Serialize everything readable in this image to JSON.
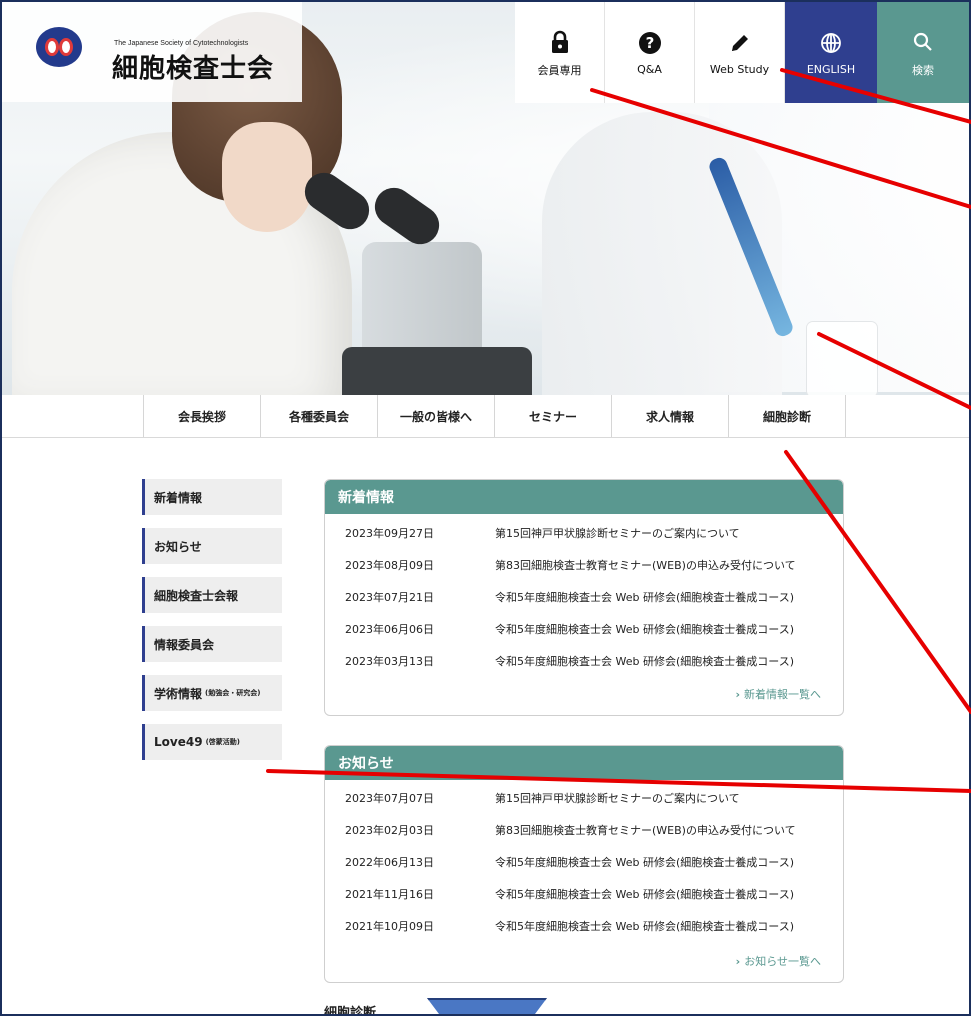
{
  "header": {
    "logo_subtitle": "The Japanese Society of Cytotechnologists",
    "logo_title": "細胞検査士会"
  },
  "topnav": [
    {
      "label": "会員専用",
      "icon": "lock-icon"
    },
    {
      "label": "Q&A",
      "icon": "question-circle-icon"
    },
    {
      "label": "Web Study",
      "icon": "pencil-icon"
    },
    {
      "label": "ENGLISH",
      "icon": "globe-icon"
    },
    {
      "label": "検索",
      "icon": "search-icon"
    }
  ],
  "gnav": [
    "会長挨拶",
    "各種委員会",
    "一般の皆様へ",
    "セミナー",
    "求人情報",
    "細胞診断"
  ],
  "side": [
    {
      "label": "新着情報",
      "note": ""
    },
    {
      "label": "お知らせ",
      "note": ""
    },
    {
      "label": "細胞検査士会報",
      "note": ""
    },
    {
      "label": "情報委員会",
      "note": ""
    },
    {
      "label": "学術情報",
      "note": "(勉強会・研究会)"
    },
    {
      "label": "Love49",
      "note": "(啓蒙活動)"
    }
  ],
  "news": {
    "title": "新着情報",
    "rows": [
      {
        "date": "2023年09月27日",
        "title": "第15回神戸甲状腺診断セミナーのご案内について"
      },
      {
        "date": "2023年08月09日",
        "title": "第83回細胞検査士教育セミナー(WEB)の申込み受付について"
      },
      {
        "date": "2023年07月21日",
        "title": "令和5年度細胞検査士会 Web 研修会(細胞検査士養成コース)"
      },
      {
        "date": "2023年06月06日",
        "title": "令和5年度細胞検査士会 Web 研修会(細胞検査士養成コース)"
      },
      {
        "date": "2023年03月13日",
        "title": "令和5年度細胞検査士会 Web 研修会(細胞検査士養成コース)"
      }
    ],
    "more": "新着情報一覧へ"
  },
  "notice": {
    "title": "お知らせ",
    "rows": [
      {
        "date": "2023年07月07日",
        "title": "第15回神戸甲状腺診断セミナーのご案内について"
      },
      {
        "date": "2023年02月03日",
        "title": "第83回細胞検査士教育セミナー(WEB)の申込み受付について"
      },
      {
        "date": "2022年06月13日",
        "title": "令和5年度細胞検査士会 Web 研修会(細胞検査士養成コース)"
      },
      {
        "date": "2021年11月16日",
        "title": "令和5年度細胞検査士会 Web 研修会(細胞検査士養成コース)"
      },
      {
        "date": "2021年10月09日",
        "title": "令和5年度細胞検査士会 Web 研修会(細胞検査士養成コース)"
      }
    ],
    "more": "お知らせ一覧へ"
  },
  "bottom_heading": "細胞診断",
  "colors": {
    "teal": "#5a9890",
    "navy": "#2f3f8f",
    "annotation_red": "#e60000"
  }
}
